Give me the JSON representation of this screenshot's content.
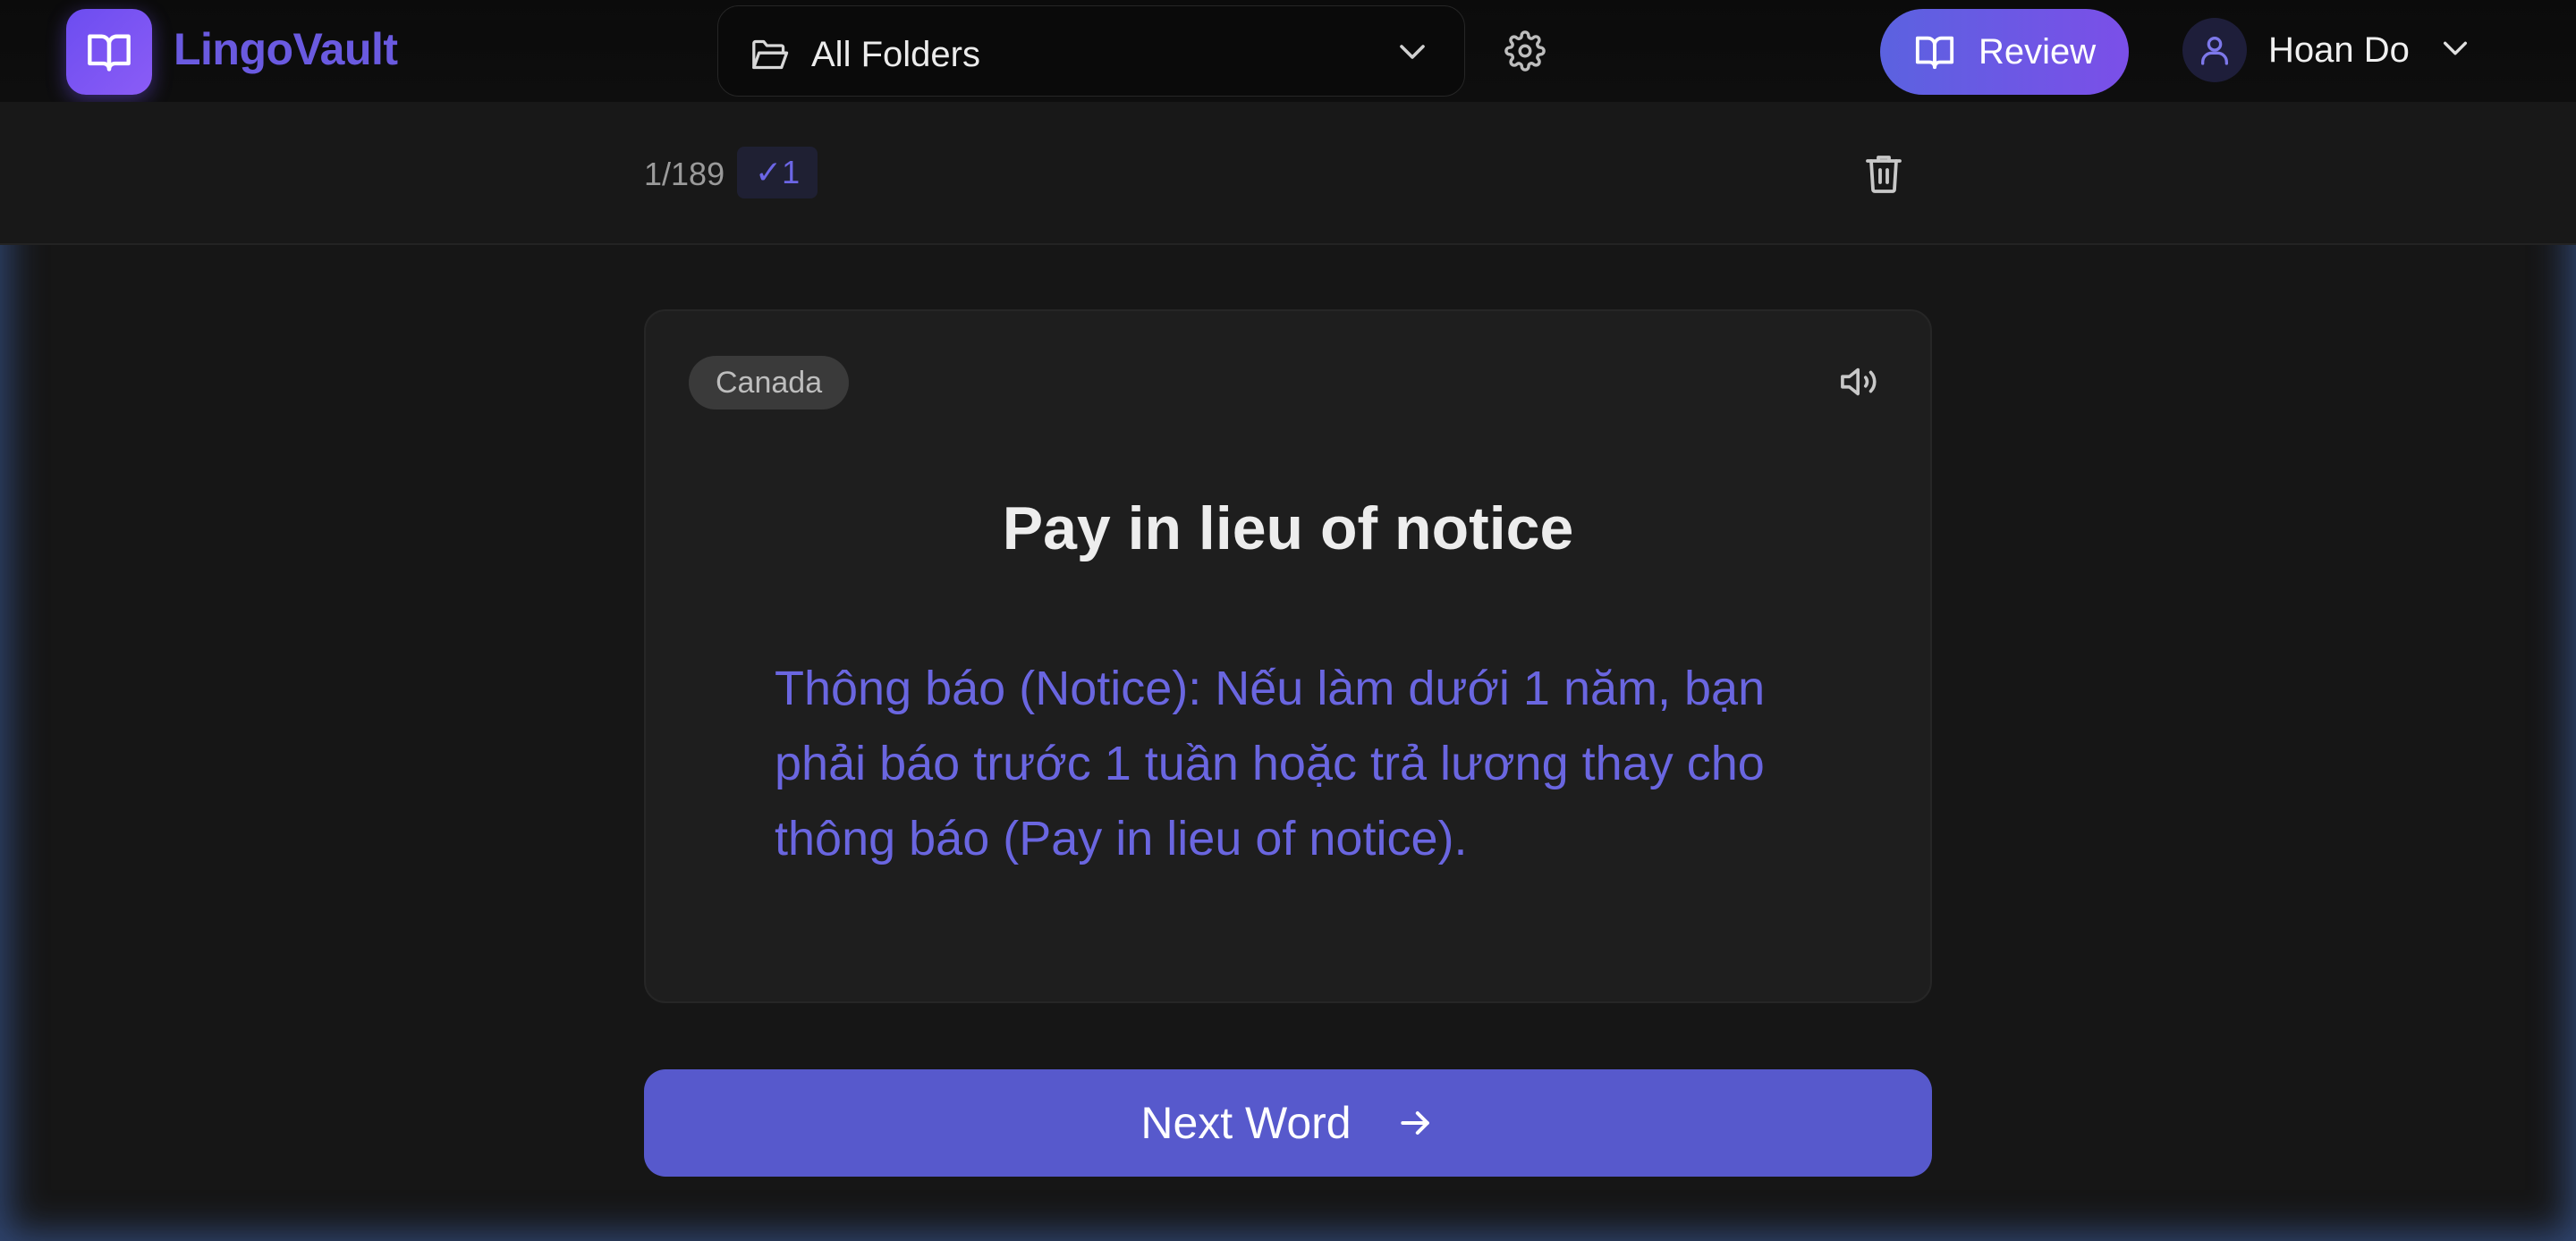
{
  "app": {
    "name": "LingoVault"
  },
  "header": {
    "folder_select": {
      "selected": "All Folders"
    },
    "review_label": "Review",
    "user_name": "Hoan Do"
  },
  "subbar": {
    "counter": "1/189",
    "known_badge": "✓1"
  },
  "card": {
    "tag": "Canada",
    "term": "Pay in lieu of notice",
    "definition": "Thông báo (Notice): Nếu làm dưới 1 năm, bạn phải báo trước 1 tuần hoặc trả lương thay cho thông báo (Pay in lieu of notice)."
  },
  "next_button": {
    "label": "Next Word"
  },
  "icons": {
    "logo": "book-open-icon",
    "folder": "folder-open-icon",
    "settings": "gear-icon",
    "review": "book-open-icon",
    "user": "user-icon",
    "delete": "trash-icon",
    "audio": "speaker-icon",
    "next": "arrow-right-icon"
  },
  "colors": {
    "accent": "#5759cc",
    "brand_text": "#6a5ae0",
    "definition_text": "#6a66e0",
    "background": "#161616"
  }
}
